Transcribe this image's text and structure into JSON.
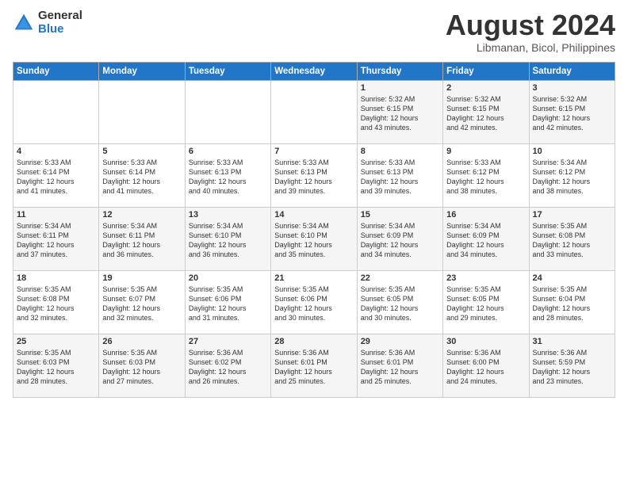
{
  "logo": {
    "general": "General",
    "blue": "Blue"
  },
  "header": {
    "month": "August 2024",
    "location": "Libmanan, Bicol, Philippines"
  },
  "weekdays": [
    "Sunday",
    "Monday",
    "Tuesday",
    "Wednesday",
    "Thursday",
    "Friday",
    "Saturday"
  ],
  "weeks": [
    [
      {
        "day": "",
        "info": ""
      },
      {
        "day": "",
        "info": ""
      },
      {
        "day": "",
        "info": ""
      },
      {
        "day": "",
        "info": ""
      },
      {
        "day": "1",
        "info": "Sunrise: 5:32 AM\nSunset: 6:15 PM\nDaylight: 12 hours\nand 43 minutes."
      },
      {
        "day": "2",
        "info": "Sunrise: 5:32 AM\nSunset: 6:15 PM\nDaylight: 12 hours\nand 42 minutes."
      },
      {
        "day": "3",
        "info": "Sunrise: 5:32 AM\nSunset: 6:15 PM\nDaylight: 12 hours\nand 42 minutes."
      }
    ],
    [
      {
        "day": "4",
        "info": "Sunrise: 5:33 AM\nSunset: 6:14 PM\nDaylight: 12 hours\nand 41 minutes."
      },
      {
        "day": "5",
        "info": "Sunrise: 5:33 AM\nSunset: 6:14 PM\nDaylight: 12 hours\nand 41 minutes."
      },
      {
        "day": "6",
        "info": "Sunrise: 5:33 AM\nSunset: 6:13 PM\nDaylight: 12 hours\nand 40 minutes."
      },
      {
        "day": "7",
        "info": "Sunrise: 5:33 AM\nSunset: 6:13 PM\nDaylight: 12 hours\nand 39 minutes."
      },
      {
        "day": "8",
        "info": "Sunrise: 5:33 AM\nSunset: 6:13 PM\nDaylight: 12 hours\nand 39 minutes."
      },
      {
        "day": "9",
        "info": "Sunrise: 5:33 AM\nSunset: 6:12 PM\nDaylight: 12 hours\nand 38 minutes."
      },
      {
        "day": "10",
        "info": "Sunrise: 5:34 AM\nSunset: 6:12 PM\nDaylight: 12 hours\nand 38 minutes."
      }
    ],
    [
      {
        "day": "11",
        "info": "Sunrise: 5:34 AM\nSunset: 6:11 PM\nDaylight: 12 hours\nand 37 minutes."
      },
      {
        "day": "12",
        "info": "Sunrise: 5:34 AM\nSunset: 6:11 PM\nDaylight: 12 hours\nand 36 minutes."
      },
      {
        "day": "13",
        "info": "Sunrise: 5:34 AM\nSunset: 6:10 PM\nDaylight: 12 hours\nand 36 minutes."
      },
      {
        "day": "14",
        "info": "Sunrise: 5:34 AM\nSunset: 6:10 PM\nDaylight: 12 hours\nand 35 minutes."
      },
      {
        "day": "15",
        "info": "Sunrise: 5:34 AM\nSunset: 6:09 PM\nDaylight: 12 hours\nand 34 minutes."
      },
      {
        "day": "16",
        "info": "Sunrise: 5:34 AM\nSunset: 6:09 PM\nDaylight: 12 hours\nand 34 minutes."
      },
      {
        "day": "17",
        "info": "Sunrise: 5:35 AM\nSunset: 6:08 PM\nDaylight: 12 hours\nand 33 minutes."
      }
    ],
    [
      {
        "day": "18",
        "info": "Sunrise: 5:35 AM\nSunset: 6:08 PM\nDaylight: 12 hours\nand 32 minutes."
      },
      {
        "day": "19",
        "info": "Sunrise: 5:35 AM\nSunset: 6:07 PM\nDaylight: 12 hours\nand 32 minutes."
      },
      {
        "day": "20",
        "info": "Sunrise: 5:35 AM\nSunset: 6:06 PM\nDaylight: 12 hours\nand 31 minutes."
      },
      {
        "day": "21",
        "info": "Sunrise: 5:35 AM\nSunset: 6:06 PM\nDaylight: 12 hours\nand 30 minutes."
      },
      {
        "day": "22",
        "info": "Sunrise: 5:35 AM\nSunset: 6:05 PM\nDaylight: 12 hours\nand 30 minutes."
      },
      {
        "day": "23",
        "info": "Sunrise: 5:35 AM\nSunset: 6:05 PM\nDaylight: 12 hours\nand 29 minutes."
      },
      {
        "day": "24",
        "info": "Sunrise: 5:35 AM\nSunset: 6:04 PM\nDaylight: 12 hours\nand 28 minutes."
      }
    ],
    [
      {
        "day": "25",
        "info": "Sunrise: 5:35 AM\nSunset: 6:03 PM\nDaylight: 12 hours\nand 28 minutes."
      },
      {
        "day": "26",
        "info": "Sunrise: 5:35 AM\nSunset: 6:03 PM\nDaylight: 12 hours\nand 27 minutes."
      },
      {
        "day": "27",
        "info": "Sunrise: 5:36 AM\nSunset: 6:02 PM\nDaylight: 12 hours\nand 26 minutes."
      },
      {
        "day": "28",
        "info": "Sunrise: 5:36 AM\nSunset: 6:01 PM\nDaylight: 12 hours\nand 25 minutes."
      },
      {
        "day": "29",
        "info": "Sunrise: 5:36 AM\nSunset: 6:01 PM\nDaylight: 12 hours\nand 25 minutes."
      },
      {
        "day": "30",
        "info": "Sunrise: 5:36 AM\nSunset: 6:00 PM\nDaylight: 12 hours\nand 24 minutes."
      },
      {
        "day": "31",
        "info": "Sunrise: 5:36 AM\nSunset: 5:59 PM\nDaylight: 12 hours\nand 23 minutes."
      }
    ]
  ]
}
